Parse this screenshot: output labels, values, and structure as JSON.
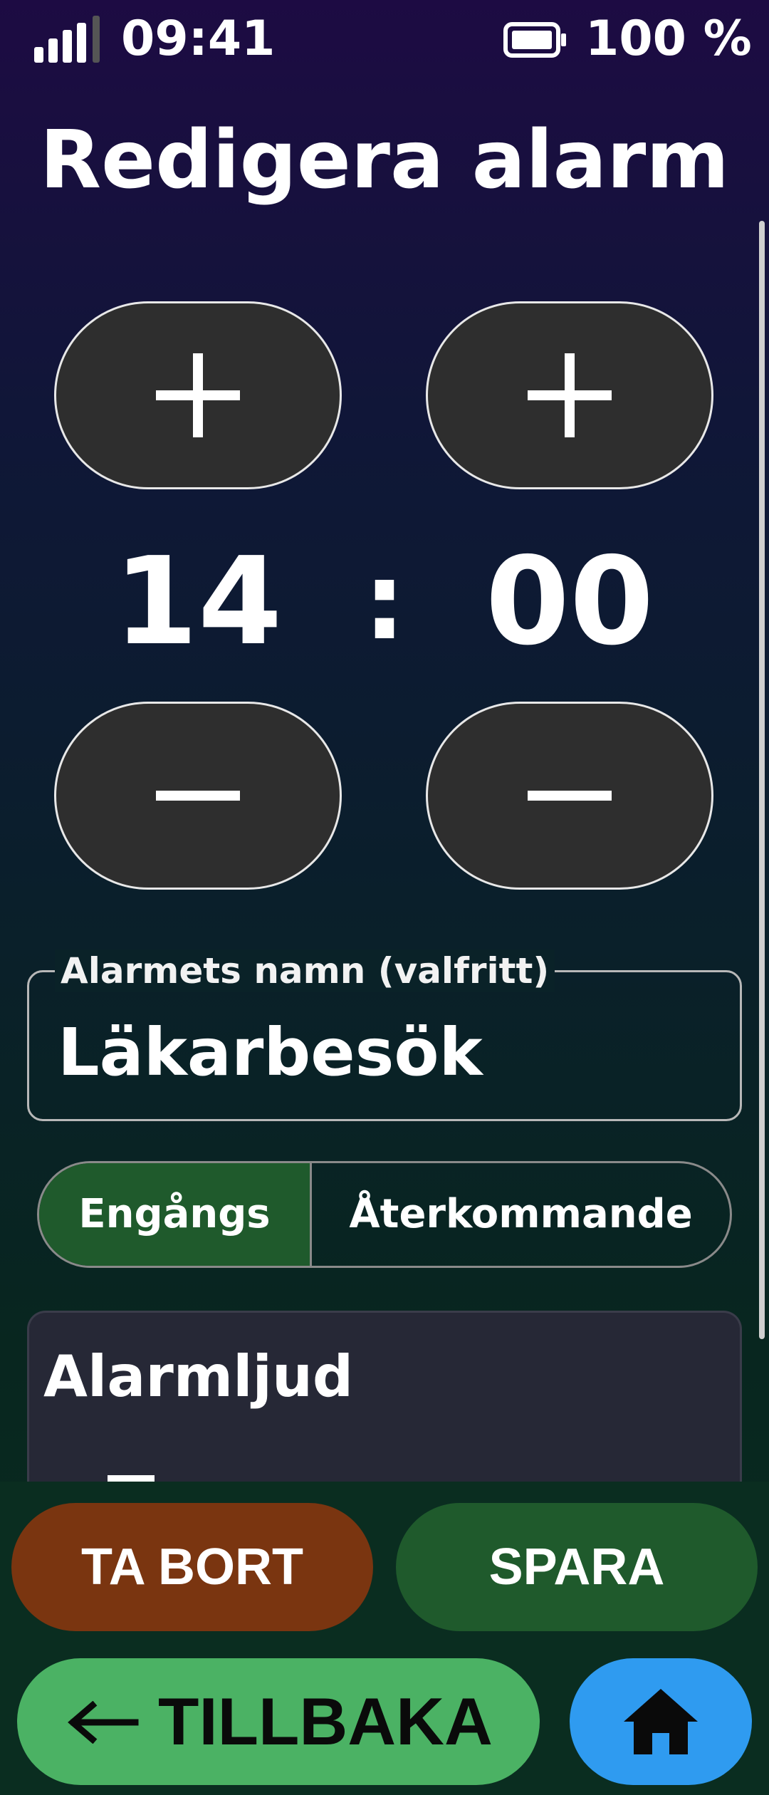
{
  "status_bar": {
    "time": "09:41",
    "battery": "100 %",
    "signal_icon": "signal-icon",
    "battery_icon": "battery-full-icon"
  },
  "header": {
    "title": "Redigera alarm"
  },
  "time_picker": {
    "hours": "14",
    "separator": ":",
    "minutes": "00",
    "increment_icon": "plus-icon",
    "decrement_icon": "minus-icon"
  },
  "name_field": {
    "label": "Alarmets namn (valfritt)",
    "value": "Läkarbesök"
  },
  "repeat_toggle": {
    "options": [
      "Engångs",
      "Återkommande"
    ],
    "selected": "Engångs"
  },
  "sound_section": {
    "title": "Alarmljud"
  },
  "actions": {
    "delete_label": "TA BORT",
    "save_label": "SPARA",
    "back_label": "TILLBAKA",
    "back_icon": "arrow-left-icon",
    "home_icon": "home-icon"
  },
  "colors": {
    "delete": "#7a3510",
    "save": "#1f5a2c",
    "back": "#4bb264",
    "home": "#2f9bf0",
    "stepper": "#2e2e2e",
    "selected_segment": "#1f5a2c"
  }
}
